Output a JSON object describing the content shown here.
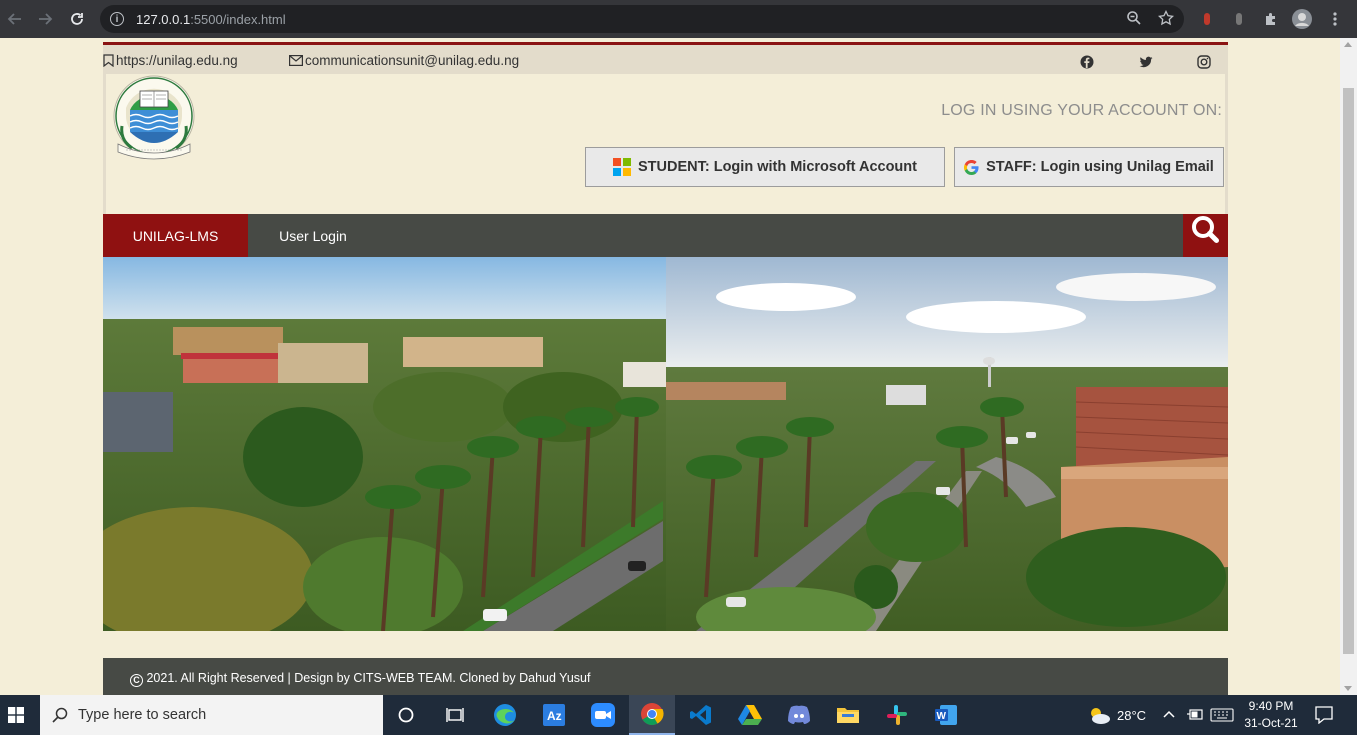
{
  "browser": {
    "url_host": "127.0.0.1",
    "url_rest": ":5500/index.html",
    "back_icon": "arrow-left-icon",
    "forward_icon": "arrow-right-icon",
    "reload_icon": "reload-icon"
  },
  "topbar": {
    "website": "https://unilag.edu.ng",
    "email": "communicationsunit@unilag.edu.ng",
    "social": [
      "facebook-icon",
      "twitter-icon",
      "instagram-icon"
    ]
  },
  "header": {
    "logo_alt": "University of Lagos logo",
    "login_title": "LOG IN USING YOUR ACCOUNT ON:",
    "student_button": "STUDENT: Login with Microsoft Account",
    "staff_button": "STAFF: Login using Unilag Email"
  },
  "nav": {
    "items": [
      "UNILAG-LMS",
      "User Login"
    ],
    "active": "UNILAG-LMS"
  },
  "footer": {
    "copyright": "2021. All Right Reserved | Design by CITS-WEB TEAM. Cloned by Dahud Yusuf"
  },
  "taskbar": {
    "search_placeholder": "Type here to search",
    "weather": "28°C",
    "time": "9:40 PM",
    "date": "31-Oct-21",
    "apps": [
      "task-view-icon",
      "edge-icon",
      "azure-icon",
      "zoom-icon",
      "chrome-icon",
      "vscode-icon",
      "google-drive-icon",
      "discord-icon",
      "file-explorer-icon",
      "slack-icon",
      "word-icon"
    ]
  },
  "colors": {
    "brand_red": "#8f1111",
    "nav_gray": "#474a45",
    "page_bg": "#f4eed8"
  }
}
